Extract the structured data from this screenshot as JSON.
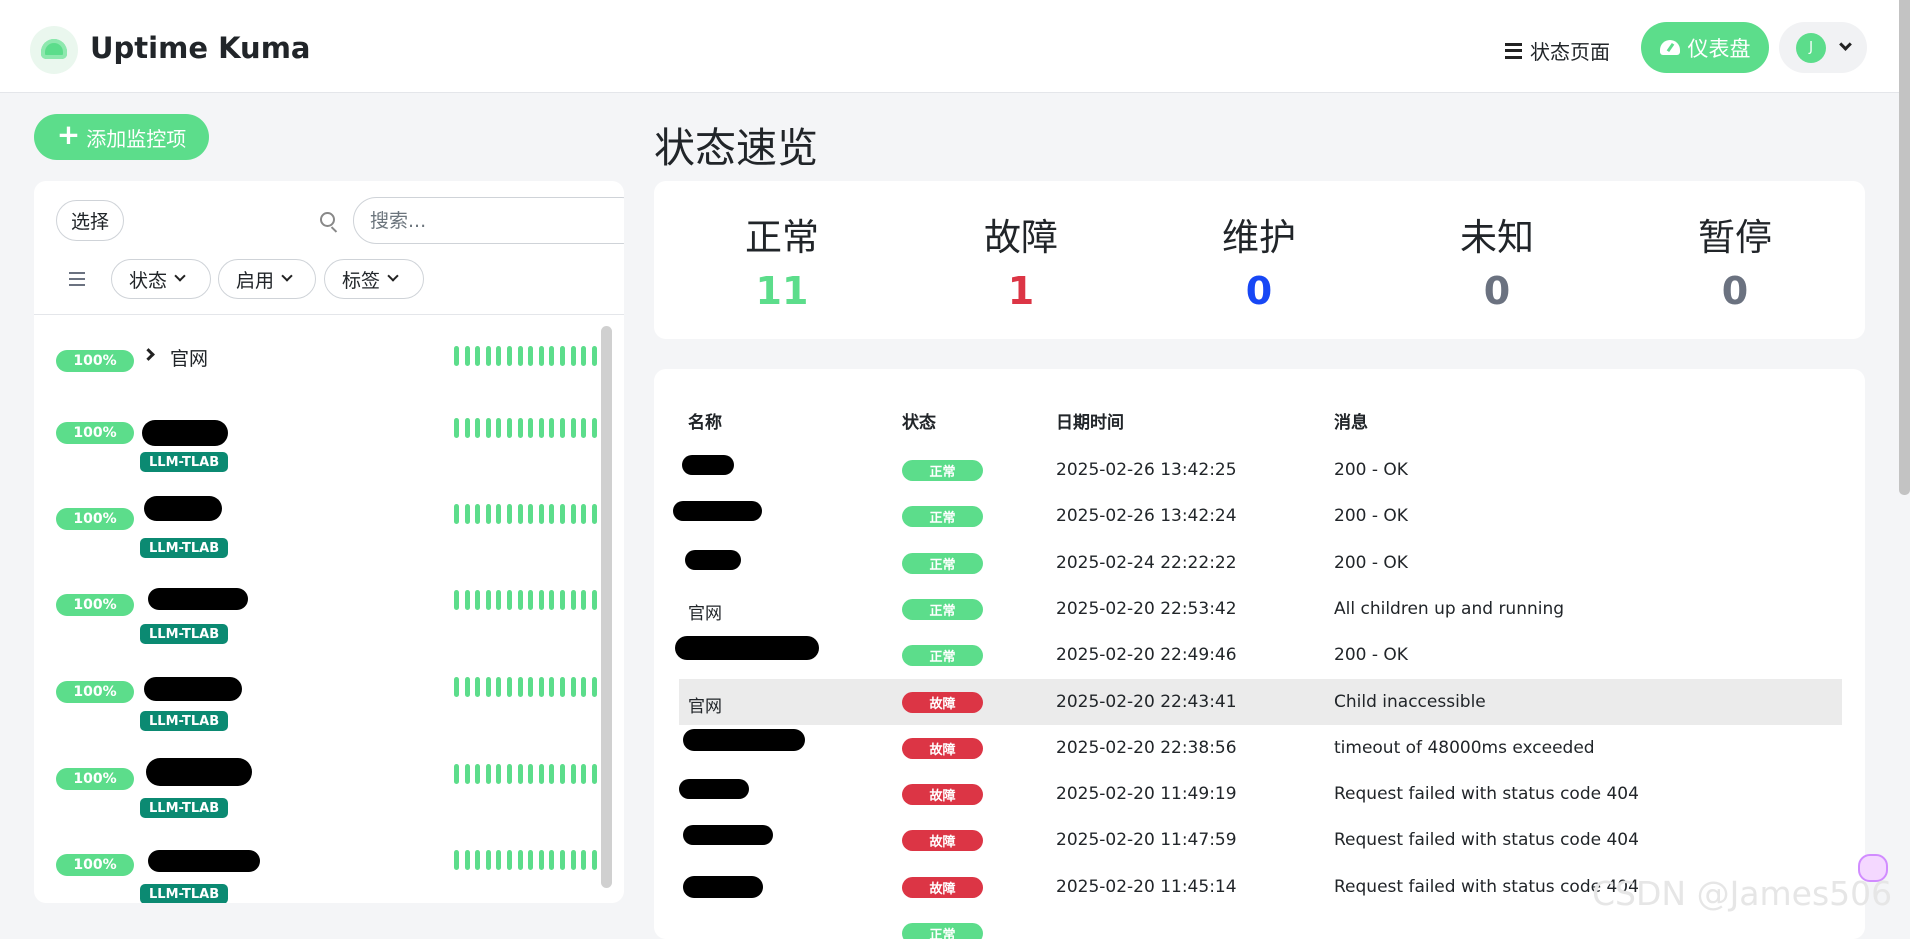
{
  "header": {
    "brand": "Uptime Kuma",
    "status_pages_label": "状态页面",
    "dashboard_label": "仪表盘",
    "avatar_initial": "J",
    "colors": {
      "accent": "#5cdd8b",
      "down": "#dc3545",
      "maintenance": "#1747f5",
      "unknown": "#6b7280"
    }
  },
  "sidebar": {
    "add_button": "添加监控项",
    "select_button": "选择",
    "search": {
      "placeholder": "搜索...",
      "value": ""
    },
    "filters": [
      "状态",
      "启用",
      "标签"
    ],
    "monitors": [
      {
        "uptime": "100%",
        "name": "官网",
        "tag": "",
        "group": true
      },
      {
        "uptime": "100%",
        "name": "",
        "tag": "LLM-TLAB"
      },
      {
        "uptime": "100%",
        "name": "",
        "tag": "LLM-TLAB"
      },
      {
        "uptime": "100%",
        "name": "",
        "tag": "LLM-TLAB"
      },
      {
        "uptime": "100%",
        "name": "",
        "tag": "LLM-TLAB"
      },
      {
        "uptime": "100%",
        "name": "",
        "tag": "LLM-TLAB"
      },
      {
        "uptime": "100%",
        "name": "",
        "tag": "LLM-TLAB"
      }
    ]
  },
  "overview": {
    "title": "状态速览",
    "stats": [
      {
        "label": "正常",
        "value": "11",
        "color": "#5cdd8b"
      },
      {
        "label": "故障",
        "value": "1",
        "color": "#dc3545"
      },
      {
        "label": "维护",
        "value": "0",
        "color": "#1747f5"
      },
      {
        "label": "未知",
        "value": "0",
        "color": "#6b7280"
      },
      {
        "label": "暂停",
        "value": "0",
        "color": "#6b7280"
      }
    ]
  },
  "events": {
    "headers": [
      "名称",
      "状态",
      "日期时间",
      "消息"
    ],
    "rows": [
      {
        "name": "",
        "status": "正常",
        "time": "2025-02-26 13:42:25",
        "message": "200 - OK"
      },
      {
        "name": "",
        "status": "正常",
        "time": "2025-02-26 13:42:24",
        "message": "200 - OK"
      },
      {
        "name": "",
        "status": "正常",
        "time": "2025-02-24 22:22:22",
        "message": "200 - OK"
      },
      {
        "name": "官网",
        "status": "正常",
        "time": "2025-02-20 22:53:42",
        "message": "All children up and running"
      },
      {
        "name": "",
        "status": "正常",
        "time": "2025-02-20 22:49:46",
        "message": "200 - OK"
      },
      {
        "name": "官网",
        "status": "故障",
        "time": "2025-02-20 22:43:41",
        "message": "Child inaccessible"
      },
      {
        "name": "",
        "status": "故障",
        "time": "2025-02-20 22:38:56",
        "message": "timeout of 48000ms exceeded"
      },
      {
        "name": "",
        "status": "故障",
        "time": "2025-02-20 11:49:19",
        "message": "Request failed with status code 404"
      },
      {
        "name": "",
        "status": "故障",
        "time": "2025-02-20 11:47:59",
        "message": "Request failed with status code 404"
      },
      {
        "name": "",
        "status": "故障",
        "time": "2025-02-20 11:45:14",
        "message": "Request failed with status code 404"
      },
      {
        "name": "",
        "status": "正常",
        "time": "",
        "message": ""
      }
    ]
  },
  "watermark": "CSDN @James506"
}
